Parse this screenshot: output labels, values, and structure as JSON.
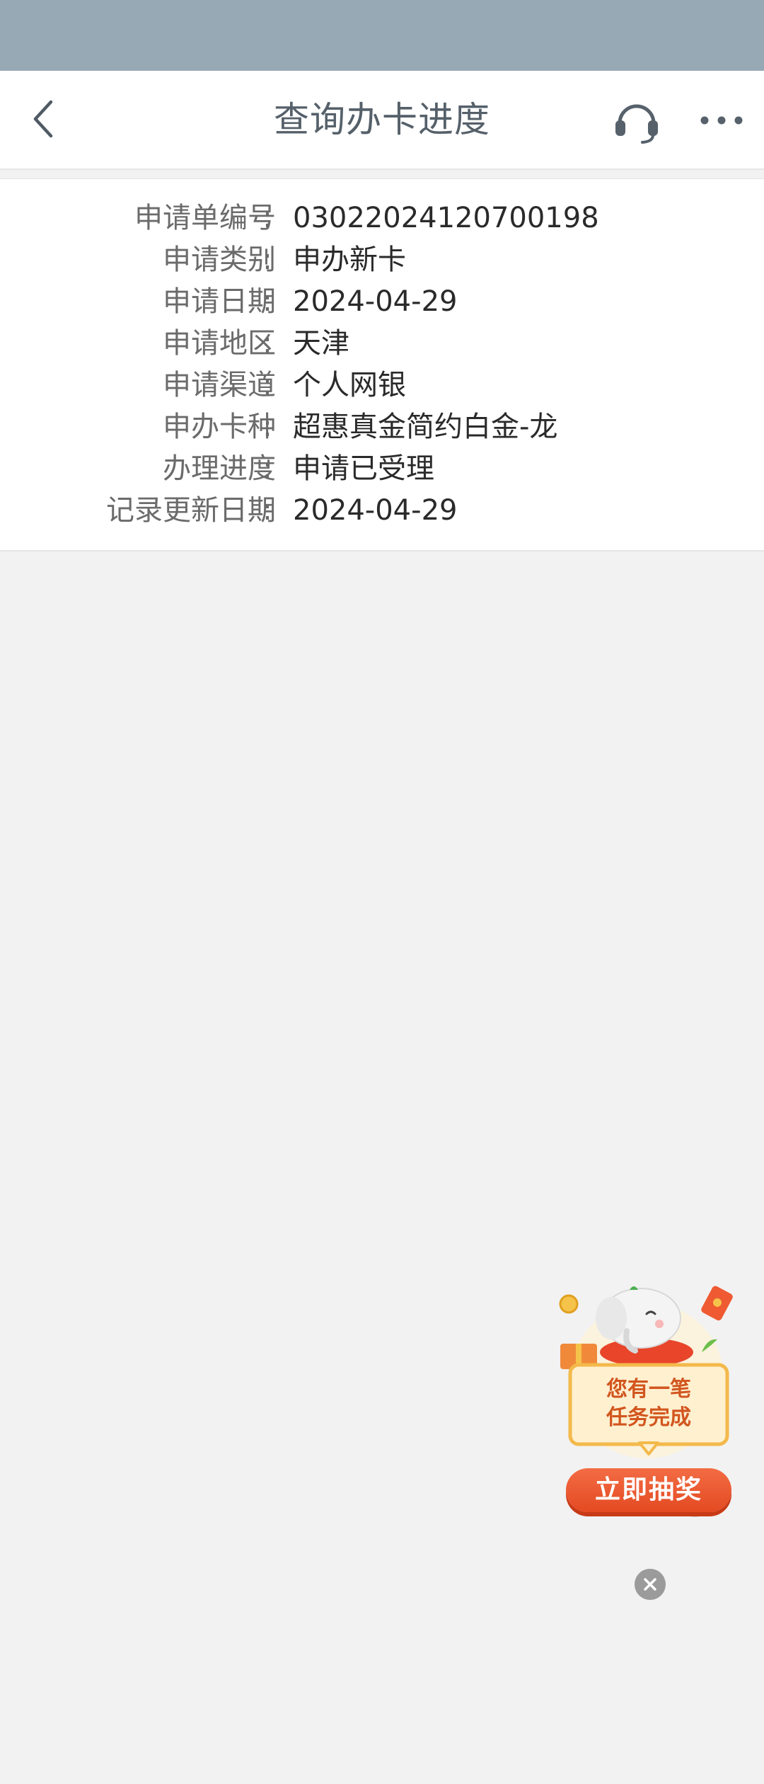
{
  "nav": {
    "title": "查询办卡进度"
  },
  "info": [
    {
      "label": "申请单编号",
      "colon": ":",
      "value": "03022024120700198"
    },
    {
      "label": "申请类别",
      "colon": ":",
      "value": "申办新卡"
    },
    {
      "label": "申请日期",
      "colon": ":",
      "value": "2024-04-29"
    },
    {
      "label": "申请地区",
      "colon": ":",
      "value": "天津"
    },
    {
      "label": "申请渠道",
      "colon": ":",
      "value": "个人网银"
    },
    {
      "label": "申办卡种",
      "colon": ":",
      "value": "超惠真金简约白金-龙"
    },
    {
      "label": "办理进度",
      "colon": ":",
      "value": "申请已受理"
    },
    {
      "label": "记录更新日期",
      "colon": ":",
      "value": "2024-04-29"
    }
  ],
  "promo": {
    "line1": "您有一笔",
    "line2": "任务完成",
    "button": "立即抽奖"
  },
  "icons": {
    "back": "chevron-left-icon",
    "service": "headset-icon",
    "more": "more-dots-icon",
    "close": "close-circle-icon"
  },
  "colors": {
    "status_bar": "#97a9b4",
    "background": "#f2f2f2",
    "title": "#55606a",
    "promo_accent": "#e44a22"
  }
}
